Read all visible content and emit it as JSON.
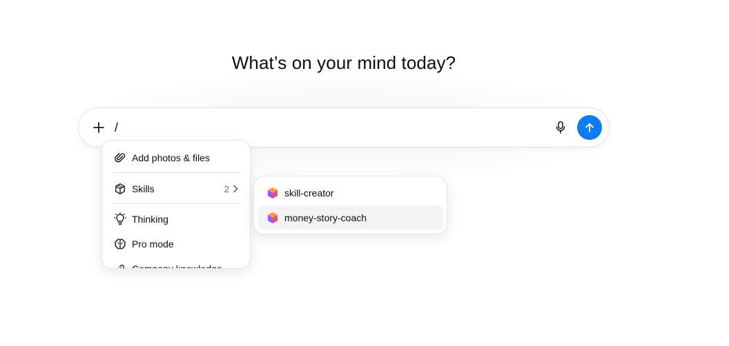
{
  "headline": "What’s on your mind today?",
  "composer": {
    "input_value": "/",
    "add_icon": "plus-icon",
    "mic_icon": "microphone-icon",
    "send_icon": "arrow-up-icon",
    "accent_color": "#0d7cf2"
  },
  "menu": {
    "items": [
      {
        "label": "Add photos & files",
        "icon": "paperclip-icon"
      },
      {
        "label": "Skills",
        "icon": "cube-icon",
        "count": "2",
        "has_submenu": true
      },
      {
        "label": "Thinking",
        "icon": "lightbulb-icon"
      },
      {
        "label": "Pro mode",
        "icon": "brain-icon"
      },
      {
        "label": "Company knowledge",
        "icon": "link-icon"
      }
    ]
  },
  "skills_submenu": {
    "items": [
      {
        "label": "skill-creator",
        "icon": "skill-cube-icon"
      },
      {
        "label": "money-story-coach",
        "icon": "skill-cube-icon",
        "highlighted": true
      }
    ]
  }
}
